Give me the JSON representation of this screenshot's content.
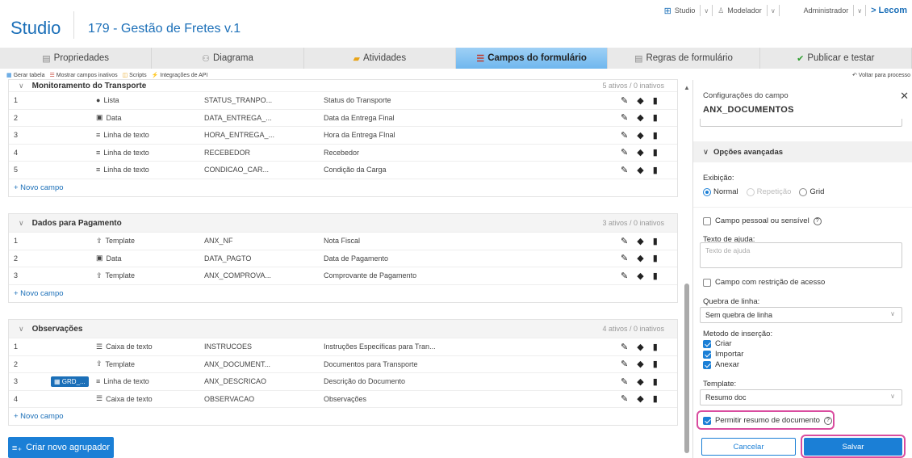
{
  "header": {
    "brand": "Studio",
    "process_title": "179 - Gestão de Fretes v.1"
  },
  "topnav": {
    "studio": "Studio",
    "modelador": "Modelador",
    "admin": "Administrador",
    "lecom": "> Lecom"
  },
  "steps": [
    {
      "label": "Propriedades",
      "icon": "file-icon"
    },
    {
      "label": "Diagrama",
      "icon": "diagram-icon"
    },
    {
      "label": "Atividades",
      "icon": "folder-icon"
    },
    {
      "label": "Campos do formulário",
      "icon": "list-icon"
    },
    {
      "label": "Regras de formulário",
      "icon": "rules-icon"
    },
    {
      "label": "Publicar e testar",
      "icon": "check-icon"
    }
  ],
  "tools": {
    "gerar_tabela": "Gerar tabela",
    "mostrar_inativos": "Mostrar campos inativos",
    "scripts": "Scripts",
    "integracoes": "Integrações de API",
    "voltar": "Voltar para processo"
  },
  "groups": [
    {
      "title": "Monitoramento do Transporte",
      "count": "5 ativos / 0 inativos",
      "rows": [
        {
          "num": "1",
          "type": "Lista",
          "code": "STATUS_TRANPO...",
          "label": "Status do Transporte"
        },
        {
          "num": "2",
          "type": "Data",
          "code": "DATA_ENTREGA_...",
          "label": "Data da Entrega Final"
        },
        {
          "num": "3",
          "type": "Linha de texto",
          "code": "HORA_ENTREGA_...",
          "label": "Hora da Entrega FInal"
        },
        {
          "num": "4",
          "type": "Linha de texto",
          "code": "RECEBEDOR",
          "label": "Recebedor"
        },
        {
          "num": "5",
          "type": "Linha de texto",
          "code": "CONDICAO_CAR...",
          "label": "Condição da Carga"
        }
      ],
      "new_field": "+ Novo campo"
    },
    {
      "title": "Dados para Pagamento",
      "count": "3 ativos / 0 inativos",
      "rows": [
        {
          "num": "1",
          "type": "Template",
          "code": "ANX_NF",
          "label": "Nota Fiscal"
        },
        {
          "num": "2",
          "type": "Data",
          "code": "DATA_PAGTO",
          "label": "Data de Pagamento"
        },
        {
          "num": "3",
          "type": "Template",
          "code": "ANX_COMPROVA...",
          "label": "Comprovante de Pagamento"
        }
      ],
      "new_field": "+ Novo campo"
    },
    {
      "title": "Observações",
      "count": "4 ativos / 0 inativos",
      "rows": [
        {
          "num": "1",
          "type": "Caixa de texto",
          "code": "INSTRUCOES",
          "label": "Instruções Específicas para Tran..."
        },
        {
          "num": "2",
          "type": "Template",
          "code": "ANX_DOCUMENT...",
          "label": "Documentos para Transporte"
        },
        {
          "num": "3",
          "type": "Linha de texto",
          "code": "ANX_DESCRICAO",
          "label": "Descrição do Documento",
          "badge": "GRD_..."
        },
        {
          "num": "4",
          "type": "Caixa de texto",
          "code": "OBSERVACAO",
          "label": "Observações"
        }
      ],
      "new_field": "+ Novo campo"
    }
  ],
  "create_group": "Criar novo agrupador",
  "panel": {
    "title": "Configurações do campo",
    "field_name": "ANX_DOCUMENTOS",
    "advanced": "Opções avançadas",
    "exibicao_label": "Exibição:",
    "exibicao_options": [
      "Normal",
      "Repetição",
      "Grid"
    ],
    "exibicao_selected": "Normal",
    "campo_pessoal": "Campo pessoal ou sensível",
    "texto_ajuda_label": "Texto de ajuda:",
    "texto_ajuda_placeholder": "Texto de ajuda",
    "restricao": "Campo com restrição de acesso",
    "quebra_label": "Quebra de linha:",
    "quebra_value": "Sem quebra de linha",
    "metodo_label": "Metodo de inserção:",
    "metodo_options": [
      {
        "label": "Criar",
        "checked": true
      },
      {
        "label": "Importar",
        "checked": true
      },
      {
        "label": "Anexar",
        "checked": true
      }
    ],
    "template_label": "Template:",
    "template_value": "Resumo doc",
    "permitir_resumo": "Permitir resumo de documento",
    "permitir_resumo_checked": true,
    "cancel": "Cancelar",
    "save": "Salvar"
  },
  "colors": {
    "brand": "#1b6fb8",
    "primary_button": "#1b7fd6",
    "highlight": "#d94c9f",
    "active_step": "#6fb7ee"
  }
}
